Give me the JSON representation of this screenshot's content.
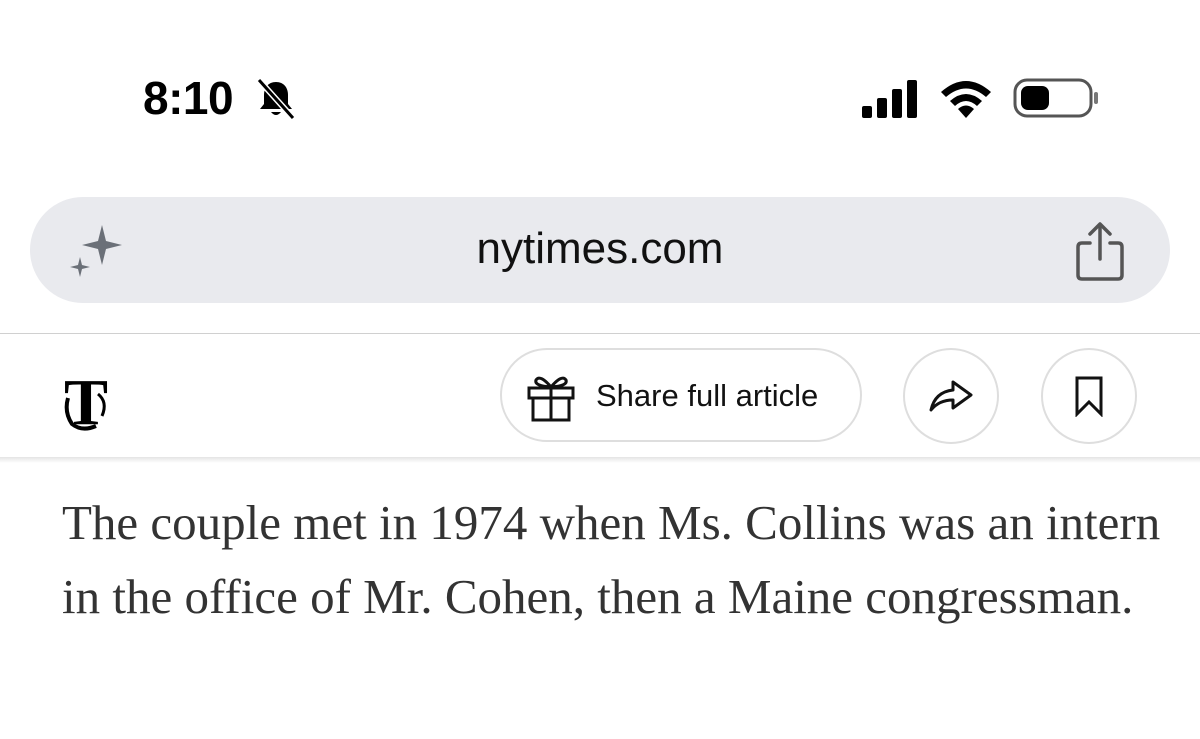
{
  "status_bar": {
    "time": "8:10",
    "icons": [
      "bell-slash-icon",
      "cellular-signal-icon",
      "wifi-icon",
      "battery-icon"
    ]
  },
  "browser": {
    "url": "nytimes.com",
    "left_icon": "sparkle-icon",
    "right_icon": "share-sheet-icon"
  },
  "article_toolbar": {
    "logo": "nyt-logo",
    "share_full_article_label": "Share full article",
    "share_icon": "share-arrow-icon",
    "bookmark_icon": "bookmark-icon"
  },
  "article": {
    "paragraph": "The couple met in 1974 when Ms. Collins was an intern in the office of Mr. Cohen, then a Maine congressman."
  },
  "colors": {
    "url_bar_bg": "#e9eaee",
    "border": "#dedede",
    "text": "#333333"
  }
}
